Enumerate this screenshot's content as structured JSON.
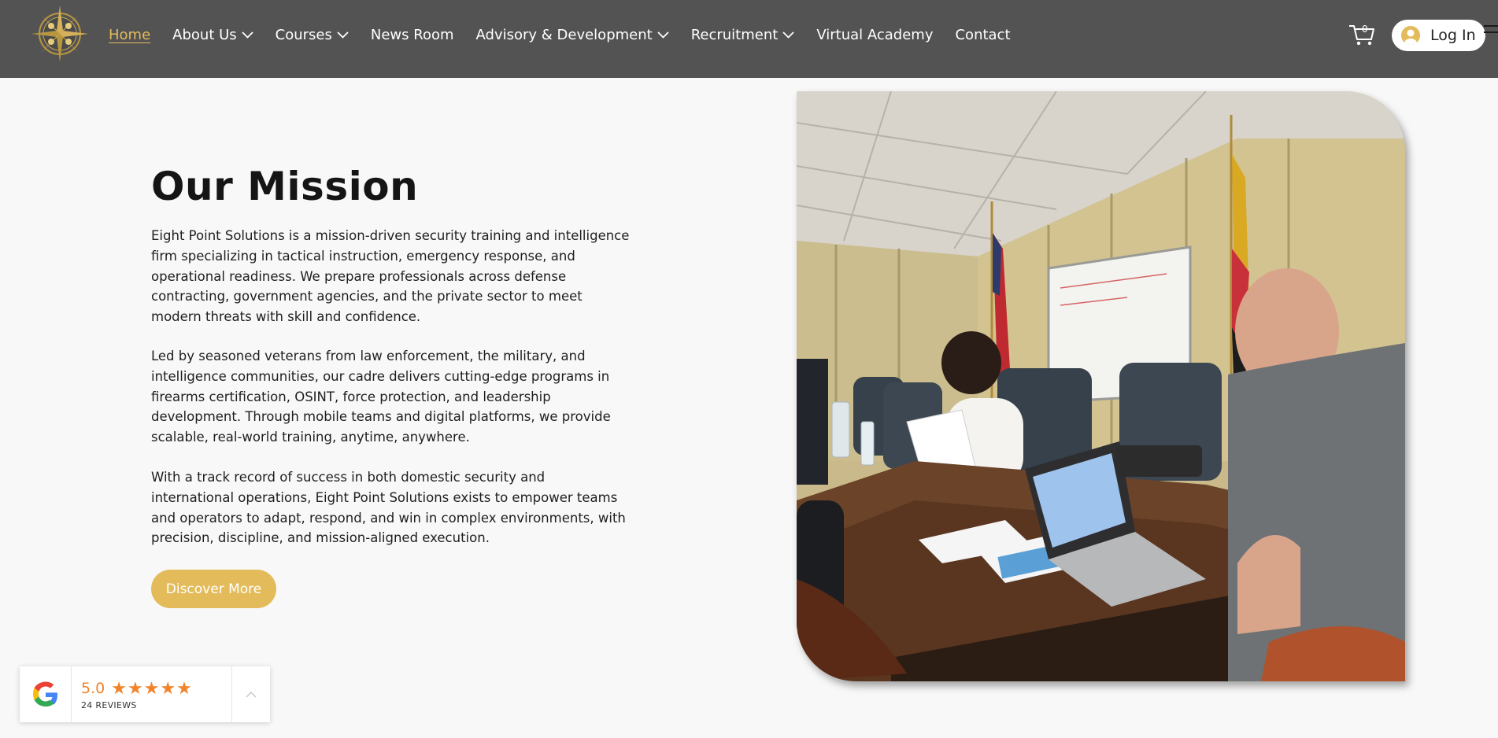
{
  "header": {
    "nav": [
      {
        "label": "Home",
        "active": true,
        "has_dropdown": false
      },
      {
        "label": "About Us",
        "active": false,
        "has_dropdown": true
      },
      {
        "label": "Courses",
        "active": false,
        "has_dropdown": true
      },
      {
        "label": "News Room",
        "active": false,
        "has_dropdown": false
      },
      {
        "label": "Advisory & Development",
        "active": false,
        "has_dropdown": true
      },
      {
        "label": "Recruitment",
        "active": false,
        "has_dropdown": true
      },
      {
        "label": "Virtual Academy",
        "active": false,
        "has_dropdown": false
      },
      {
        "label": "Contact",
        "active": false,
        "has_dropdown": false
      }
    ],
    "cart_count": "0",
    "login_label": "Log In"
  },
  "mission": {
    "title": "Our Mission",
    "paragraphs": [
      "Eight Point Solutions is a mission-driven security training and intelligence firm specializing in tactical instruction, emergency response, and operational readiness. We prepare professionals across defense contracting, government agencies, and the private sector to meet modern threats with skill and confidence.",
      "Led by seasoned veterans from law enforcement, the military, and intelligence communities, our cadre delivers cutting-edge programs in firearms certification, OSINT, force protection, and leadership development. Through mobile teams and digital platforms, we provide scalable, real-world training, anytime, anywhere.",
      "With a track record of success in both domestic security and international operations, Eight Point Solutions exists to empower teams and operators to adapt, respond, and win in complex environments, with precision, discipline, and mission-aligned execution."
    ],
    "cta_label": "Discover More"
  },
  "reviews": {
    "rating": "5.0",
    "stars": "★★★★★",
    "count_label": "24 REVIEWS"
  },
  "colors": {
    "header_bg": "#535353",
    "accent_gold": "#e3bb5a",
    "star_orange": "#f1832b",
    "page_bg": "#f8f8f8"
  }
}
